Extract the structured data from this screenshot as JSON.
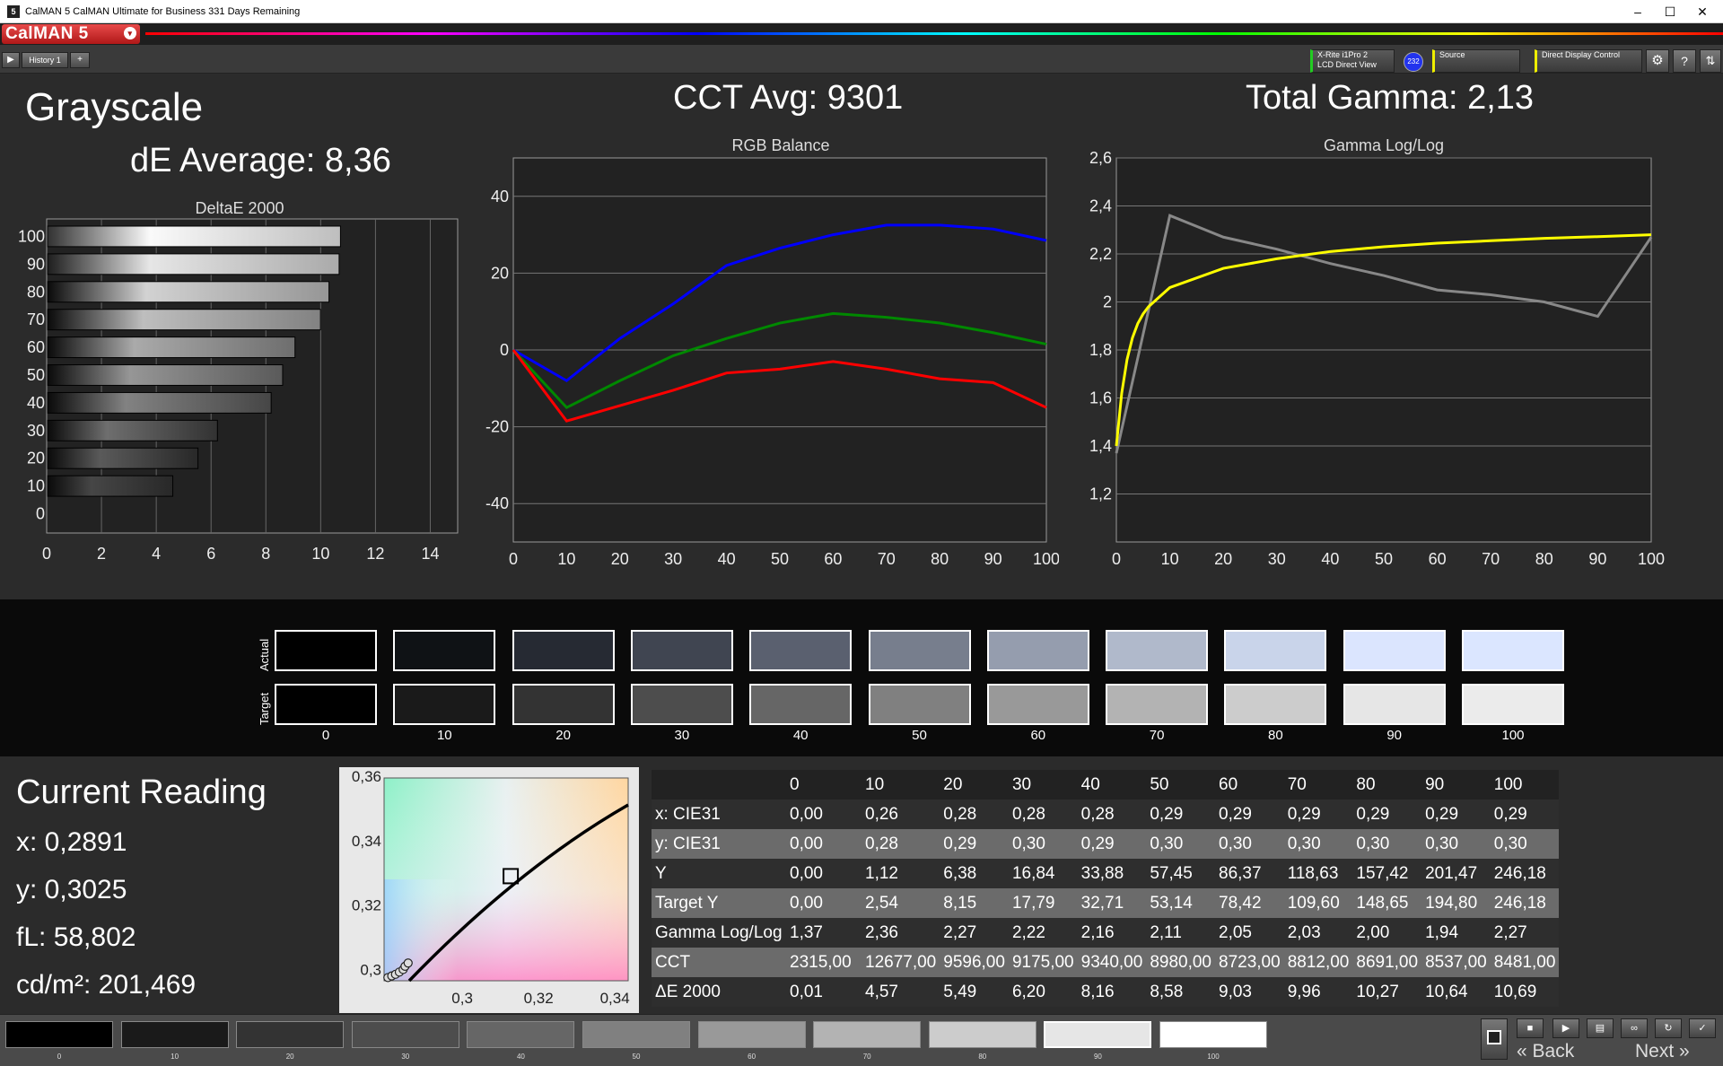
{
  "window": {
    "title": "CalMAN 5 CalMAN Ultimate for Business 331 Days Remaining",
    "app_icon": "5",
    "minimize": "–",
    "maximize": "☐",
    "close": "✕"
  },
  "brand": {
    "logo": "CalMAN 5",
    "logo_dropdown": "▾"
  },
  "toolbar": {
    "history_tab": "History 1",
    "meter_line1": "X-Rite i1Pro 2",
    "meter_line2": "LCD Direct View",
    "meter_badge": "232",
    "source_label": "Source",
    "display_label": "Direct Display Control"
  },
  "grayscale": {
    "title": "Grayscale",
    "de_average": "dE Average: 8,36",
    "cct_avg": "CCT Avg: 9301",
    "total_gamma": "Total Gamma: 2,13"
  },
  "chart_data": [
    {
      "type": "bar",
      "orientation": "horizontal",
      "title": "DeltaE 2000",
      "categories": [
        "100",
        "90",
        "80",
        "70",
        "60",
        "50",
        "40",
        "30",
        "20",
        "10",
        "0"
      ],
      "values": [
        10.69,
        10.64,
        10.27,
        9.96,
        9.03,
        8.58,
        8.16,
        6.2,
        5.49,
        4.57,
        0.01
      ],
      "xlim": [
        0,
        15
      ],
      "xticks": [
        "0",
        "2",
        "4",
        "6",
        "8",
        "10",
        "12",
        "14"
      ],
      "grid": true
    },
    {
      "type": "line",
      "title": "RGB Balance",
      "x": [
        0,
        10,
        20,
        30,
        40,
        50,
        60,
        70,
        80,
        90,
        100
      ],
      "series": [
        {
          "color": "#0000ff",
          "values": [
            0,
            -8,
            3,
            12,
            22,
            26.5,
            30,
            32.5,
            32.5,
            31.5,
            28.5
          ]
        },
        {
          "color": "#008800",
          "values": [
            0,
            -15,
            -8,
            -1.5,
            3,
            7,
            9.5,
            8.5,
            7,
            4.5,
            1.5
          ]
        },
        {
          "color": "#ff0000",
          "values": [
            0,
            -18.5,
            -14.5,
            -10.5,
            -6,
            -5,
            -3,
            -5,
            -7.5,
            -8.5,
            -15
          ]
        }
      ],
      "xlim": [
        0,
        100
      ],
      "ylim": [
        -50,
        50
      ],
      "xticks": [
        "0",
        "10",
        "20",
        "30",
        "40",
        "50",
        "60",
        "70",
        "80",
        "90",
        "100"
      ],
      "yticks": [
        "40",
        "20",
        "0",
        "-20",
        "-40"
      ],
      "grid": true
    },
    {
      "type": "line",
      "title": "Gamma Log/Log",
      "x": [
        0,
        10,
        20,
        30,
        40,
        50,
        60,
        70,
        80,
        90,
        100
      ],
      "series": [
        {
          "color": "#888888",
          "values": [
            1.37,
            2.36,
            2.27,
            2.22,
            2.16,
            2.11,
            2.05,
            2.03,
            2.0,
            1.94,
            2.27
          ]
        },
        {
          "color": "#ffff00",
          "curve": "target",
          "values": [
            1.4,
            2.06,
            2.14,
            2.18,
            2.21,
            2.23,
            2.245,
            2.255,
            2.265,
            2.272,
            2.28
          ]
        }
      ],
      "xlim": [
        0,
        100
      ],
      "ylim": [
        1.0,
        2.6
      ],
      "xticks": [
        "0",
        "10",
        "20",
        "30",
        "40",
        "50",
        "60",
        "70",
        "80",
        "90",
        "100"
      ],
      "yticks": [
        "2,6",
        "2,4",
        "2,2",
        "2",
        "1,8",
        "1,6",
        "1,4",
        "1,2"
      ],
      "grid": true
    },
    {
      "type": "scatter",
      "title": "CIE 1931 xy",
      "xlim": [
        0.2795,
        0.3435
      ],
      "ylim": [
        0.2965,
        0.3595
      ],
      "xticks": [
        "0,3",
        "0,32",
        "0,34"
      ],
      "yticks": [
        "0,36",
        "0,34",
        "0,32",
        "0,3"
      ],
      "target_point": {
        "x": 0.3127,
        "y": 0.329
      },
      "points": [
        {
          "x": 0.2805,
          "y": 0.2975
        },
        {
          "x": 0.2815,
          "y": 0.298
        },
        {
          "x": 0.2825,
          "y": 0.2985
        },
        {
          "x": 0.2835,
          "y": 0.2992
        },
        {
          "x": 0.2845,
          "y": 0.3
        },
        {
          "x": 0.285,
          "y": 0.301
        },
        {
          "x": 0.2858,
          "y": 0.302
        }
      ]
    }
  ],
  "swatches": {
    "actual_label": "Actual",
    "target_label": "Target",
    "labels": [
      "0",
      "10",
      "20",
      "30",
      "40",
      "50",
      "60",
      "70",
      "80",
      "90",
      "100"
    ],
    "actual_colors": [
      "#000000",
      "#0f1215",
      "#262a33",
      "#404551",
      "#5a606f",
      "#777e8d",
      "#959dae",
      "#b0b9cb",
      "#c9d4ea",
      "#dbe5fe",
      "#dbe6ff"
    ],
    "target_colors": [
      "#000000",
      "#1a1a1a",
      "#333333",
      "#4d4d4d",
      "#666666",
      "#808080",
      "#999999",
      "#b3b3b3",
      "#cccccc",
      "#e6e6e6",
      "#ebebeb"
    ]
  },
  "current_reading": {
    "title": "Current Reading",
    "x": "x: 0,2891",
    "y": "y: 0,3025",
    "fl": "fL: 58,802",
    "cdm2": "cd/m²: 201,469"
  },
  "table": {
    "columns": [
      "",
      "0",
      "10",
      "20",
      "30",
      "40",
      "50",
      "60",
      "70",
      "80",
      "90",
      "100"
    ],
    "rows": [
      [
        "x: CIE31",
        "0,00",
        "0,26",
        "0,28",
        "0,28",
        "0,28",
        "0,29",
        "0,29",
        "0,29",
        "0,29",
        "0,29",
        "0,29"
      ],
      [
        "y: CIE31",
        "0,00",
        "0,28",
        "0,29",
        "0,30",
        "0,29",
        "0,30",
        "0,30",
        "0,30",
        "0,30",
        "0,30",
        "0,30"
      ],
      [
        "Y",
        "0,00",
        "1,12",
        "6,38",
        "16,84",
        "33,88",
        "57,45",
        "86,37",
        "118,63",
        "157,42",
        "201,47",
        "246,18"
      ],
      [
        "Target Y",
        "0,00",
        "2,54",
        "8,15",
        "17,79",
        "32,71",
        "53,14",
        "78,42",
        "109,60",
        "148,65",
        "194,80",
        "246,18"
      ],
      [
        "Gamma Log/Log",
        "1,37",
        "2,36",
        "2,27",
        "2,22",
        "2,16",
        "2,11",
        "2,05",
        "2,03",
        "2,00",
        "1,94",
        "2,27"
      ],
      [
        "CCT",
        "2315,00",
        "12677,00",
        "9596,00",
        "9175,00",
        "9340,00",
        "8980,00",
        "8723,00",
        "8812,00",
        "8691,00",
        "8537,00",
        "8481,00"
      ],
      [
        "ΔE 2000",
        "0,01",
        "4,57",
        "5,49",
        "6,20",
        "8,16",
        "8,58",
        "9,03",
        "9,96",
        "10,27",
        "10,64",
        "10,69"
      ]
    ]
  },
  "bottom": {
    "labels": [
      "0",
      "10",
      "20",
      "30",
      "40",
      "50",
      "60",
      "70",
      "80",
      "90",
      "100"
    ],
    "colors": [
      "#000000",
      "#1a1a1a",
      "#333333",
      "#4d4d4d",
      "#666666",
      "#808080",
      "#999999",
      "#b3b3b3",
      "#cccccc",
      "#e6e6e6",
      "#ffffff"
    ],
    "back": "Back",
    "next": "Next"
  }
}
